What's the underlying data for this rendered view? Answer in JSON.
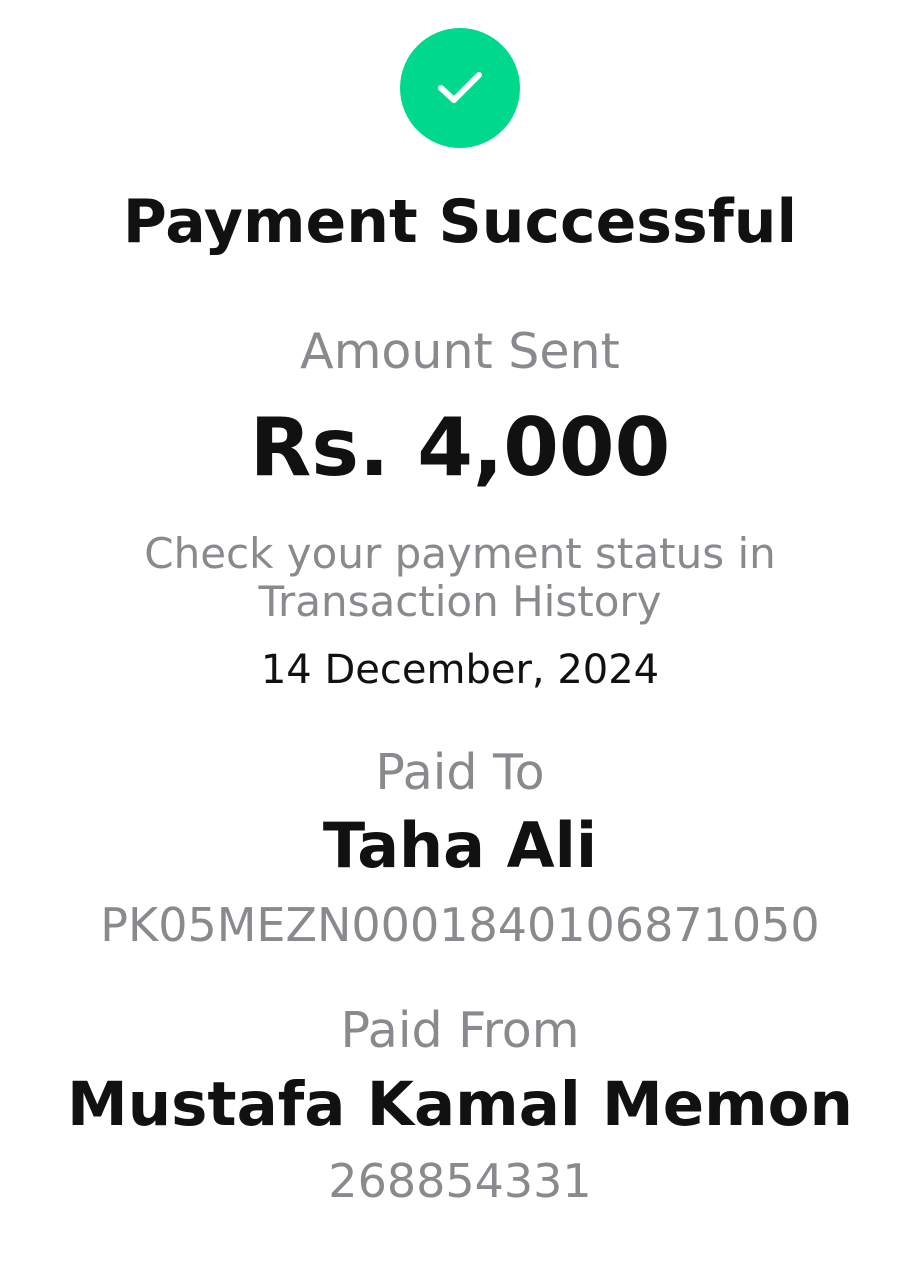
{
  "status": {
    "icon": "check-icon",
    "icon_color": "#00D98B",
    "title": "Payment Successful"
  },
  "amount": {
    "label": "Amount Sent",
    "value": "Rs. 4,000"
  },
  "note": {
    "line1": "Check your payment status in",
    "line2": "Transaction History"
  },
  "date": "14 December, 2024",
  "recipient": {
    "label": "Paid To",
    "name": "Taha Ali",
    "account": "PK05MEZN0001840106871050"
  },
  "sender": {
    "label": "Paid From",
    "name": "Mustafa Kamal Memon",
    "account": "268854331"
  }
}
